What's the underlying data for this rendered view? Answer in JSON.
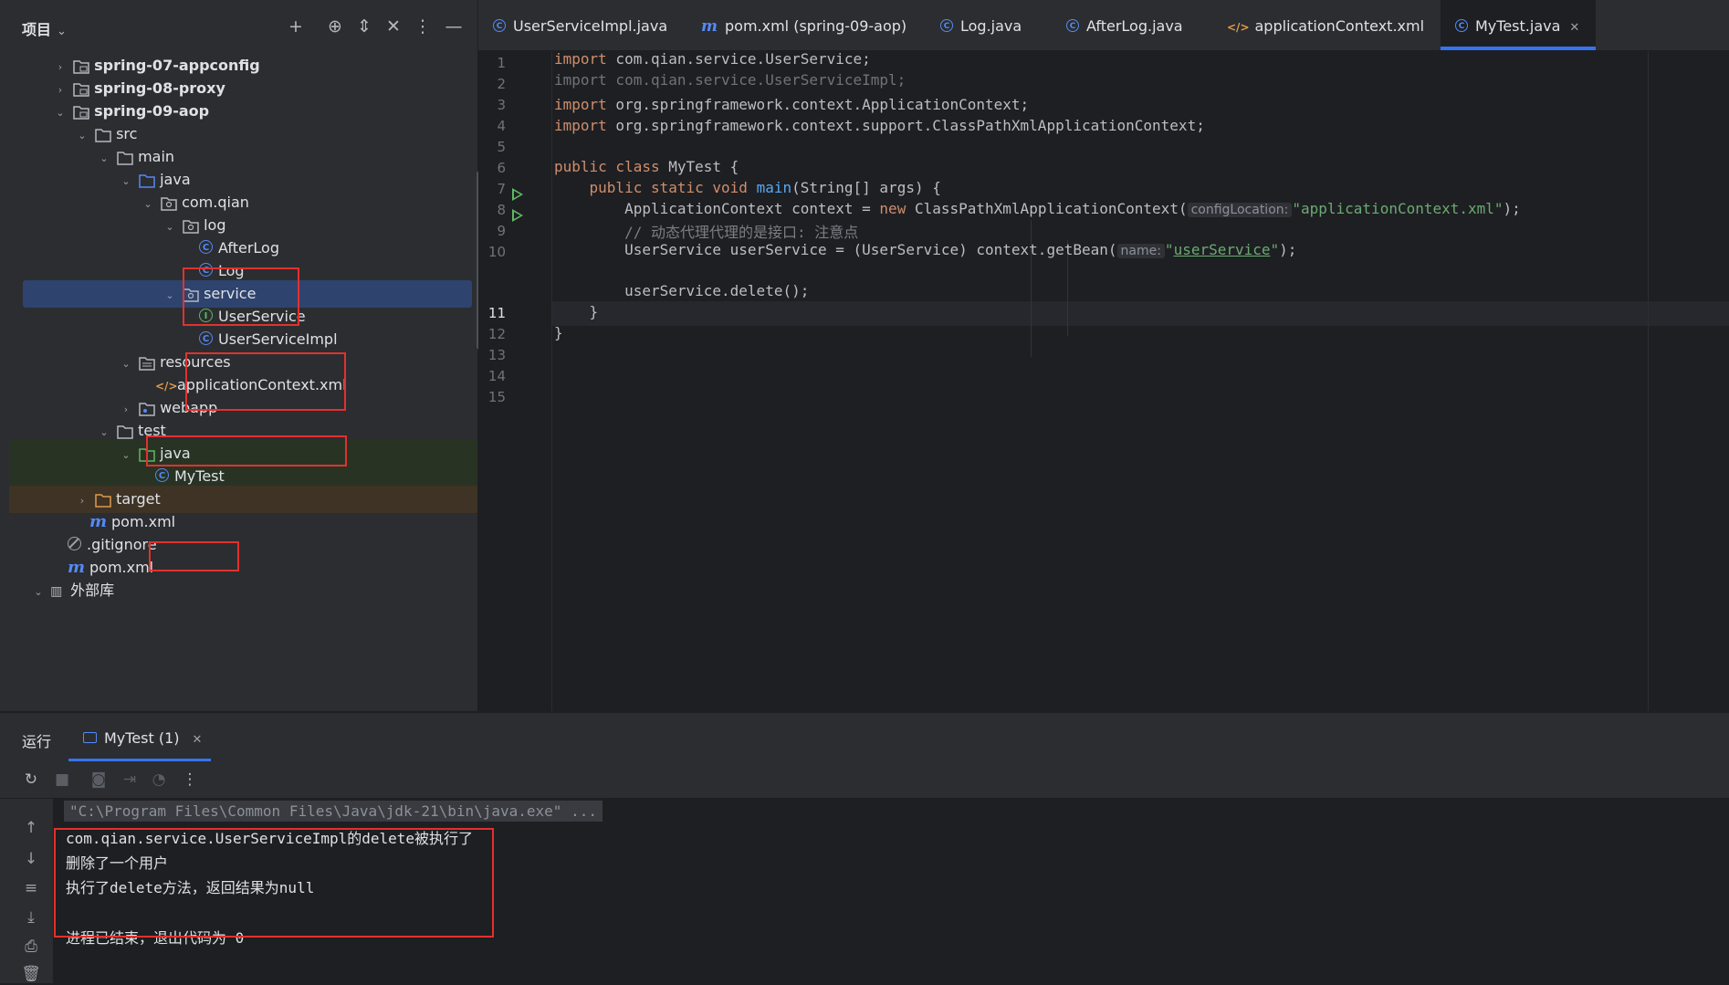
{
  "project_panel": {
    "title": "项目",
    "tree": [
      {
        "label": "spring-07-appconfig",
        "type": "module"
      },
      {
        "label": "spring-08-proxy",
        "type": "module"
      },
      {
        "label": "spring-09-aop",
        "type": "module"
      },
      {
        "label": "src",
        "type": "folder"
      },
      {
        "label": "main",
        "type": "folder"
      },
      {
        "label": "java",
        "type": "source-root"
      },
      {
        "label": "com.qian",
        "type": "package"
      },
      {
        "label": "log",
        "type": "package"
      },
      {
        "label": "AfterLog",
        "type": "class"
      },
      {
        "label": "Log",
        "type": "class"
      },
      {
        "label": "service",
        "type": "package",
        "selected": true
      },
      {
        "label": "UserService",
        "type": "interface"
      },
      {
        "label": "UserServiceImpl",
        "type": "class"
      },
      {
        "label": "resources",
        "type": "resources-root"
      },
      {
        "label": "applicationContext.xml",
        "type": "xml"
      },
      {
        "label": "webapp",
        "type": "folder"
      },
      {
        "label": "test",
        "type": "folder"
      },
      {
        "label": "java",
        "type": "test-root"
      },
      {
        "label": "MyTest",
        "type": "test-class"
      },
      {
        "label": "target",
        "type": "excluded-folder"
      },
      {
        "label": "pom.xml",
        "type": "maven"
      },
      {
        "label": ".gitignore",
        "type": "ignore"
      },
      {
        "label": "pom.xml",
        "type": "maven"
      },
      {
        "label": "外部库",
        "type": "library"
      }
    ]
  },
  "editor_tabs": [
    {
      "label": "UserServiceImpl.java",
      "icon": "class-icon"
    },
    {
      "label": "pom.xml (spring-09-aop)",
      "icon": "maven-icon"
    },
    {
      "label": "Log.java",
      "icon": "class-icon"
    },
    {
      "label": "AfterLog.java",
      "icon": "class-icon"
    },
    {
      "label": "applicationContext.xml",
      "icon": "xml-icon"
    },
    {
      "label": "MyTest.java",
      "icon": "test-class-icon",
      "active": true
    }
  ],
  "editor": {
    "line_numbers": [
      "1",
      "2",
      "3",
      "4",
      "5",
      "6",
      "7",
      "8",
      "9",
      "10",
      "11",
      "12",
      "13",
      "14",
      "15"
    ],
    "current_line": "11",
    "lines": {
      "l1_kw": "import",
      "l1_rest": " com.qian.service.UserService;",
      "l2": "import com.qian.service.UserServiceImpl;",
      "l3_kw": "import",
      "l3_rest": " org.springframework.context.ApplicationContext;",
      "l4_kw": "import",
      "l4_rest": " org.springframework.context.support.ClassPathXmlApplicationContext;",
      "l6_kw": "public class",
      "l6_rest": " MyTest {",
      "l7_kw": "public static void",
      "l7_fn": "main",
      "l7_rest": "(String[] args) {",
      "l8_a": "ApplicationContext context = ",
      "l8_kw": "new",
      "l8_b": " ClassPathXmlApplicationContext(",
      "l8_hint": "configLocation:",
      "l8_str": "\"applicationContext.xml\"",
      "l8_end": ");",
      "l9": "// 动态代理代理的是接口: 注意点",
      "l10_a": "UserService userService = (UserService) context.getBean(",
      "l10_hint": "name:",
      "l10_q1": "\"",
      "l10_link": "userService",
      "l10_q2": "\"",
      "l10_end": ");",
      "l12": "userService.delete();",
      "l13": "}",
      "l14": "}"
    }
  },
  "run_panel": {
    "title": "运行",
    "tab_label": "MyTest (1)",
    "console": [
      "\"C:\\Program Files\\Common Files\\Java\\jdk-21\\bin\\java.exe\" ...",
      "com.qian.service.UserServiceImpl的delete被执行了",
      "删除了一个用户",
      "执行了delete方法，返回结果为null",
      "进程已结束，退出代码为 0"
    ]
  },
  "colors": {
    "highlight_box": "#e2312e",
    "accent": "#3574f0",
    "selection": "#2e436e"
  }
}
